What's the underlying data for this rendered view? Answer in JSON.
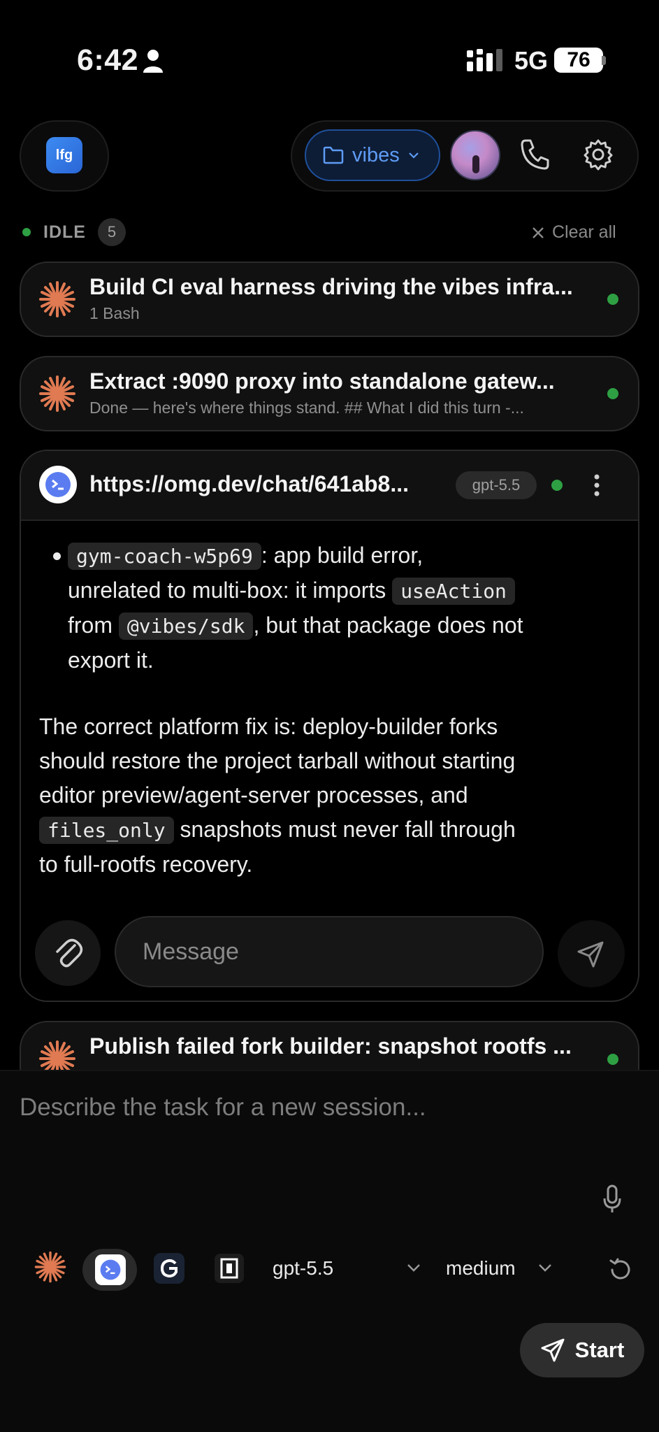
{
  "status_bar": {
    "time": "6:42",
    "network": "5G",
    "battery": "76"
  },
  "header": {
    "logo_text": "lfg",
    "project_label": "vibes",
    "icons": {
      "folder": "folder-icon",
      "phone": "phone-icon",
      "settings": "gear-icon"
    },
    "accent_color": "#5e9cf5"
  },
  "sessions_bar": {
    "status": "IDLE",
    "count": "5",
    "clear_all": "Clear all"
  },
  "tasks": [
    {
      "title": "Build CI eval harness driving the vibes infra...",
      "subtitle": "1 Bash"
    },
    {
      "title": "Extract :9090 proxy into standalone gatew...",
      "subtitle": "Done — here's where things stand. ## What I did this turn -..."
    },
    {
      "title": "Publish failed fork builder: snapshot rootfs ...",
      "subtitle": ""
    }
  ],
  "chat": {
    "url": "https://omg.dev/chat/641ab8...",
    "model": "gpt-5.5",
    "message": {
      "bullet_code": "gym-coach-w5p69",
      "bullet_text_1": ": app build error,",
      "bullet_text_2": "unrelated to multi-box: it imports",
      "code_use_action": "useAction",
      "bullet_text_3": "from",
      "code_sdk": "@vibes/sdk",
      "bullet_text_4": ", but that package does not",
      "bullet_text_5": "export it.",
      "para_line_1": "The correct platform fix is: deploy-builder forks",
      "para_line_2": "should restore the project tarball without starting",
      "para_line_3": "editor preview/agent-server processes, and",
      "code_files_only": "files_only",
      "para_line_4": "snapshots must never fall through",
      "para_line_5": "to full-rootfs recovery."
    },
    "input_placeholder": "Message"
  },
  "composer": {
    "placeholder": "Describe the task for a new session...",
    "model": "gpt-5.5",
    "effort": "medium",
    "start_label": "Start"
  },
  "colors": {
    "status_green": "#2ea043",
    "claude_orange": "#e07a52"
  }
}
